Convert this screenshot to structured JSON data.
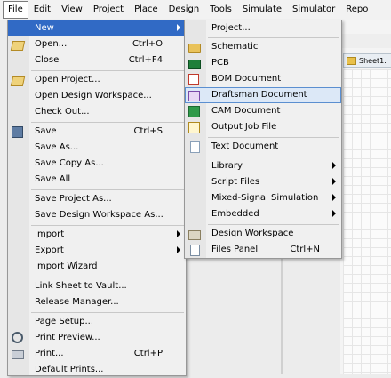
{
  "menubar": {
    "items": [
      "File",
      "Edit",
      "View",
      "Project",
      "Place",
      "Design",
      "Tools",
      "Simulate",
      "Simulator",
      "Repo"
    ]
  },
  "background": {
    "tab_label": "Sheet1."
  },
  "file_menu": {
    "items": [
      {
        "label": "New",
        "shortcut": "",
        "icon": "none",
        "submenu": true,
        "highlighted": true
      },
      {
        "label": "Open...",
        "shortcut": "Ctrl+O",
        "icon": "open-folder-icon"
      },
      {
        "label": "Close",
        "shortcut": "Ctrl+F4",
        "icon": "none"
      },
      {
        "label": "Open Project...",
        "shortcut": "",
        "icon": "open-project-icon"
      },
      {
        "label": "Open Design Workspace...",
        "shortcut": "",
        "icon": "none"
      },
      {
        "label": "Check Out...",
        "shortcut": "",
        "icon": "none"
      },
      {
        "label": "Save",
        "shortcut": "Ctrl+S",
        "icon": "save-icon"
      },
      {
        "label": "Save As...",
        "shortcut": "",
        "icon": "none"
      },
      {
        "label": "Save Copy As...",
        "shortcut": "",
        "icon": "none"
      },
      {
        "label": "Save All",
        "shortcut": "",
        "icon": "none"
      },
      {
        "label": "Save Project As...",
        "shortcut": "",
        "icon": "none"
      },
      {
        "label": "Save Design Workspace As...",
        "shortcut": "",
        "icon": "none"
      },
      {
        "label": "Import",
        "shortcut": "",
        "icon": "none",
        "submenu": true
      },
      {
        "label": "Export",
        "shortcut": "",
        "icon": "none",
        "submenu": true
      },
      {
        "label": "Import Wizard",
        "shortcut": "",
        "icon": "none"
      },
      {
        "label": "Link Sheet to Vault...",
        "shortcut": "",
        "icon": "none"
      },
      {
        "label": "Release Manager...",
        "shortcut": "",
        "icon": "none"
      },
      {
        "label": "Page Setup...",
        "shortcut": "",
        "icon": "none"
      },
      {
        "label": "Print Preview...",
        "shortcut": "",
        "icon": "print-preview-icon"
      },
      {
        "label": "Print...",
        "shortcut": "Ctrl+P",
        "icon": "printer-icon"
      },
      {
        "label": "Default Prints...",
        "shortcut": "",
        "icon": "none"
      }
    ]
  },
  "new_submenu": {
    "items": [
      {
        "label": "Project...",
        "shortcut": "",
        "icon": "none"
      },
      {
        "label": "Schematic",
        "shortcut": "",
        "icon": "schematic-icon"
      },
      {
        "label": "PCB",
        "shortcut": "",
        "icon": "pcb-icon"
      },
      {
        "label": "BOM Document",
        "shortcut": "",
        "icon": "bom-document-icon"
      },
      {
        "label": "Draftsman Document",
        "shortcut": "",
        "icon": "draftsman-document-icon",
        "selected": true
      },
      {
        "label": "CAM Document",
        "shortcut": "",
        "icon": "cam-document-icon"
      },
      {
        "label": "Output Job File",
        "shortcut": "",
        "icon": "output-job-file-icon"
      },
      {
        "label": "Text Document",
        "shortcut": "",
        "icon": "text-document-icon"
      },
      {
        "label": "Library",
        "shortcut": "",
        "icon": "none",
        "submenu": true
      },
      {
        "label": "Script Files",
        "shortcut": "",
        "icon": "none",
        "submenu": true
      },
      {
        "label": "Mixed-Signal Simulation",
        "shortcut": "",
        "icon": "none",
        "submenu": true
      },
      {
        "label": "Embedded",
        "shortcut": "",
        "icon": "none",
        "submenu": true
      },
      {
        "label": "Design Workspace",
        "shortcut": "",
        "icon": "design-workspace-icon"
      },
      {
        "label": "Files Panel",
        "shortcut": "Ctrl+N",
        "icon": "files-panel-icon"
      }
    ]
  }
}
